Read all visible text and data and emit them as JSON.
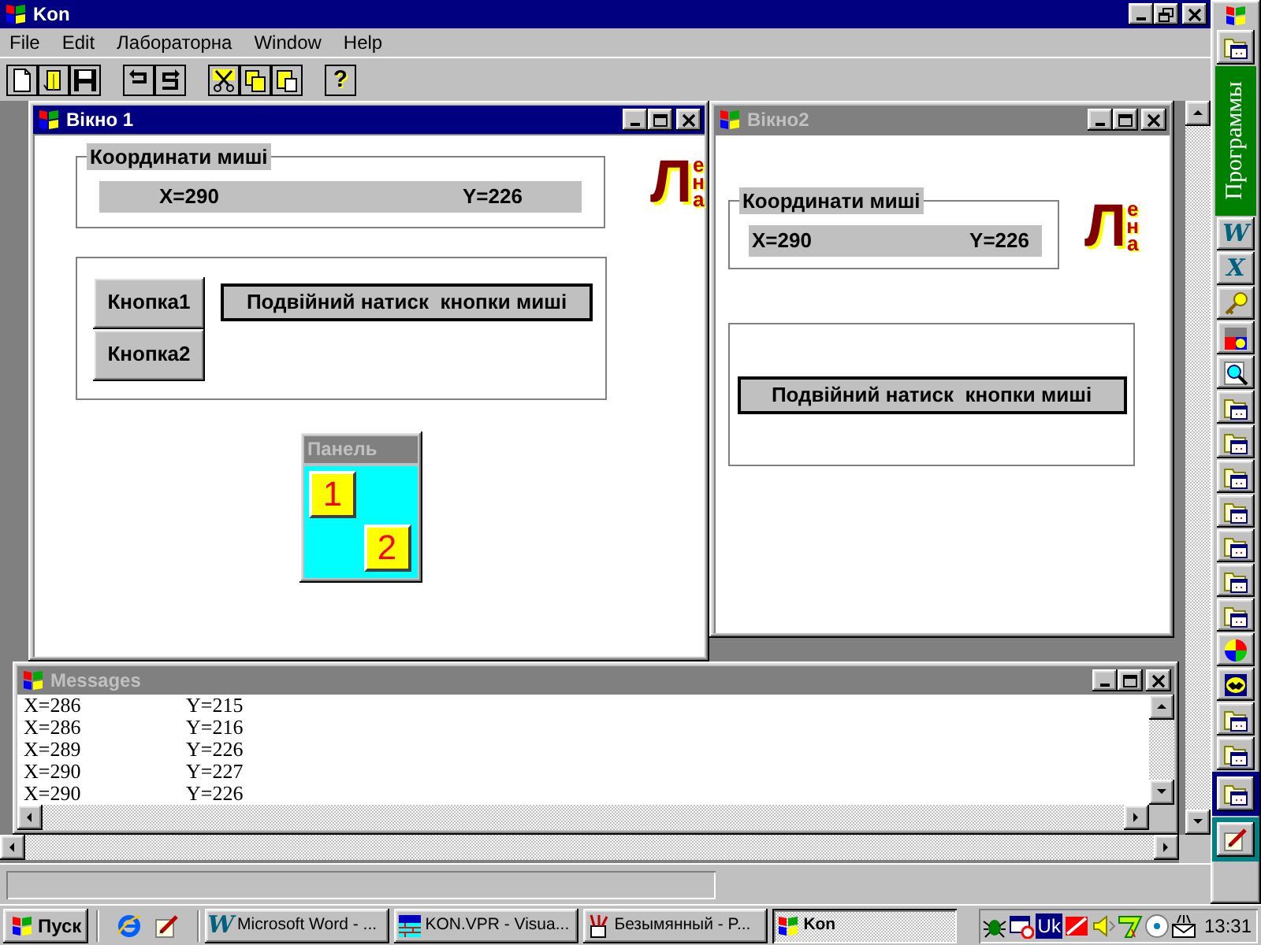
{
  "app": {
    "title": "Kon",
    "active": true
  },
  "menu": [
    {
      "label": "File"
    },
    {
      "label": "Edit"
    },
    {
      "label": "Лабораторна"
    },
    {
      "label": "Window"
    },
    {
      "label": "Help"
    }
  ],
  "toolbar": [
    [
      {
        "kind": "new"
      },
      {
        "kind": "open"
      },
      {
        "kind": "save"
      }
    ],
    [
      {
        "kind": "undo"
      },
      {
        "kind": "redo"
      }
    ],
    [
      {
        "kind": "cut"
      },
      {
        "kind": "copy"
      },
      {
        "kind": "paste"
      }
    ],
    [
      {
        "kind": "glyph",
        "glyph": "?"
      }
    ]
  ],
  "window_1": {
    "title": "Вікно 1",
    "active": true,
    "coords": {
      "label": "Координати миші",
      "x": "X=290",
      "y": "Y=226"
    },
    "logo": {
      "big": "Л",
      "small": [
        "е",
        "н",
        "а"
      ]
    },
    "buttons": [
      "Кнопка1",
      "Кнопка2"
    ],
    "double_click_label": "Подвійний натиск  кнопки миші",
    "panel": {
      "title": "Панель",
      "tiles": [
        "1",
        "2"
      ]
    }
  },
  "window_2": {
    "title": "Вікно2",
    "active": false,
    "coords": {
      "label": "Координати миші",
      "x": "X=290",
      "y": "Y=226"
    },
    "logo": {
      "big": "Л",
      "small": [
        "е",
        "н",
        "а"
      ]
    },
    "double_click_label": "Подвійний натиск  кнопки миші"
  },
  "messages": {
    "title": "Messages",
    "active": false,
    "rows": [
      {
        "x": "X=286",
        "y": "Y=215"
      },
      {
        "x": "X=286",
        "y": "Y=216"
      },
      {
        "x": "X=289",
        "y": "Y=226"
      },
      {
        "x": "X=290",
        "y": "Y=227"
      },
      {
        "x": "X=290",
        "y": "Y=226"
      }
    ]
  },
  "office_bar": {
    "label": "Программы",
    "buttons": [
      {
        "kind": "letter",
        "glyph": "W"
      },
      {
        "kind": "letter",
        "glyph": "X"
      },
      {
        "kind": "key"
      },
      {
        "kind": "blocks"
      },
      {
        "kind": "find"
      },
      {
        "kind": "folder"
      },
      {
        "kind": "folder"
      },
      {
        "kind": "folder"
      },
      {
        "kind": "folder"
      },
      {
        "kind": "folder"
      },
      {
        "kind": "folder"
      },
      {
        "kind": "folder"
      },
      {
        "kind": "palette"
      },
      {
        "kind": "bat"
      },
      {
        "kind": "folder"
      },
      {
        "kind": "folder"
      }
    ],
    "sections": [
      {
        "color": "#000080",
        "buttons": [
          {
            "kind": "folder"
          }
        ]
      },
      {
        "color": "#008080",
        "buttons": [
          {
            "kind": "pen"
          }
        ]
      }
    ]
  },
  "taskbar": {
    "start": "Пуск",
    "quick_launch": [
      {
        "kind": "globe"
      },
      {
        "kind": "pen"
      }
    ],
    "tasks": [
      {
        "label": "Microsoft Word - ...",
        "selected": false,
        "icon": {
          "kind": "letter",
          "glyph": "W"
        }
      },
      {
        "label": "KON.VPR - Visua...",
        "selected": false,
        "icon": {
          "kind": "bricks"
        }
      },
      {
        "label": "Безымянный - P...",
        "selected": false,
        "icon": {
          "kind": "brushes"
        }
      },
      {
        "label": "Kon",
        "selected": true,
        "icon": {
          "kind": "flag"
        }
      }
    ],
    "tray": {
      "items": [
        {
          "kind": "bug"
        },
        {
          "kind": "calendar"
        },
        {
          "kind": "text",
          "text": "Uk"
        },
        {
          "kind": "slash"
        },
        {
          "kind": "speaker"
        },
        {
          "kind": "seven"
        },
        {
          "kind": "disc"
        },
        {
          "kind": "mail"
        }
      ],
      "clock": "13:31"
    }
  }
}
